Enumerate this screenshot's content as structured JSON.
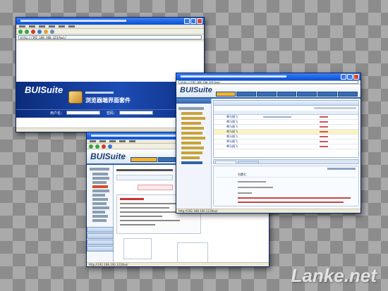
{
  "login_window": {
    "address": "http://192.168.100.123/bui/",
    "brand": "BUISuite",
    "title": "浏览器端界面套件",
    "username_label": "用户名：",
    "password_label": "密码："
  },
  "grid_window": {
    "address": "http://192.168.100.123/bui/",
    "brand": "BUISuite",
    "rows": [
      {
        "name": "喝马随飞"
      },
      {
        "name": "喝马随飞"
      },
      {
        "name": "喝马随飞"
      },
      {
        "name": "喝马随飞"
      },
      {
        "name": "喝马随飞"
      },
      {
        "name": "喝马随飞"
      },
      {
        "name": "喝马随飞"
      }
    ],
    "form_value": "为第七",
    "status_text": "http://192.168.100.123/bui/"
  },
  "demo_window": {
    "brand": "BUISuite",
    "status_text": "http://192.168.100.123/bui/"
  },
  "watermark": "Lanke.net",
  "colors": {
    "title_bar": "#0a4fd6",
    "login_banner": "#13398f",
    "accent": "#f2b230"
  }
}
